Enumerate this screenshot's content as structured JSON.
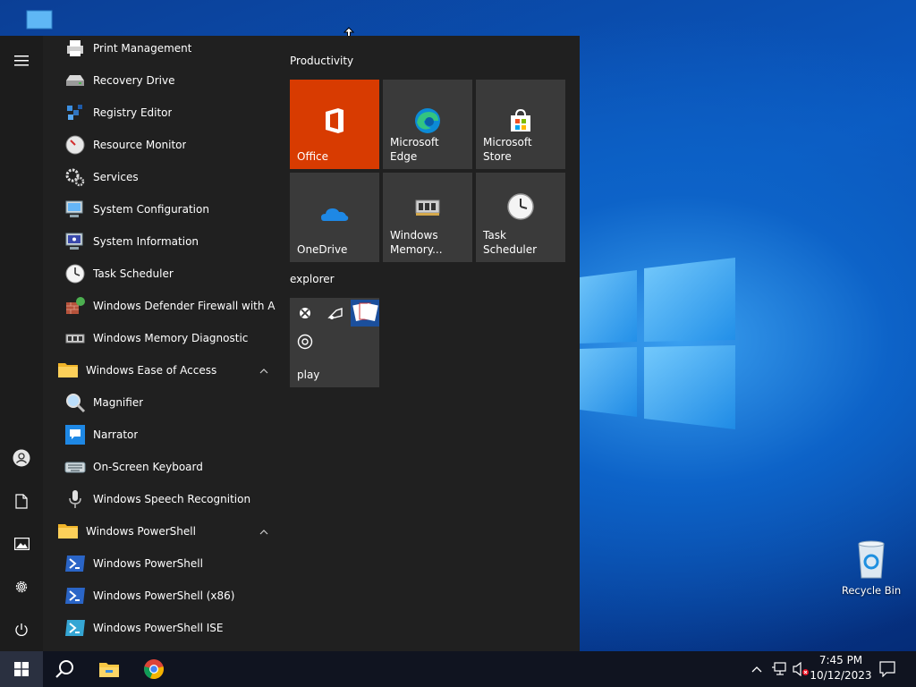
{
  "desktop": {
    "icons": [
      {
        "name": "Recycle Bin"
      }
    ]
  },
  "start_menu": {
    "rail": {
      "menu_icon": "hamburger-icon",
      "user_icon": "user-icon",
      "documents_icon": "document-icon",
      "pictures_icon": "pictures-icon",
      "settings_icon": "gear-icon",
      "power_icon": "power-icon"
    },
    "apps": [
      {
        "name": "Print Management",
        "icon": "print-management-icon"
      },
      {
        "name": "Recovery Drive",
        "icon": "drive-icon"
      },
      {
        "name": "Registry Editor",
        "icon": "registry-icon"
      },
      {
        "name": "Resource Monitor",
        "icon": "resource-monitor-icon"
      },
      {
        "name": "Services",
        "icon": "services-gear-icon"
      },
      {
        "name": "System Configuration",
        "icon": "system-configuration-icon"
      },
      {
        "name": "System Information",
        "icon": "system-information-icon"
      },
      {
        "name": "Task Scheduler",
        "icon": "clock-icon"
      },
      {
        "name": "Windows Defender Firewall with Ad...",
        "icon": "firewall-icon"
      },
      {
        "name": "Windows Memory Diagnostic",
        "icon": "memory-chip-icon"
      },
      {
        "name": "Windows Ease of Access",
        "icon": "folder-icon",
        "folder": true,
        "expanded": true
      },
      {
        "name": "Magnifier",
        "icon": "magnifier-icon"
      },
      {
        "name": "Narrator",
        "icon": "narrator-icon"
      },
      {
        "name": "On-Screen Keyboard",
        "icon": "keyboard-icon"
      },
      {
        "name": "Windows Speech Recognition",
        "icon": "microphone-icon"
      },
      {
        "name": "Windows PowerShell",
        "icon": "folder-icon",
        "folder": true,
        "expanded": true
      },
      {
        "name": "Windows PowerShell",
        "icon": "powershell-icon"
      },
      {
        "name": "Windows PowerShell (x86)",
        "icon": "powershell-icon"
      },
      {
        "name": "Windows PowerShell ISE",
        "icon": "powershell-ise-icon"
      }
    ],
    "tile_groups": [
      {
        "title": "Productivity",
        "tiles": [
          {
            "label": "Office",
            "icon": "office-icon",
            "bg": "#d83b01"
          },
          {
            "label": "Microsoft Edge",
            "icon": "edge-icon",
            "bg": "#3a3a3a"
          },
          {
            "label": "Microsoft Store",
            "icon": "store-icon",
            "bg": "#3a3a3a"
          },
          {
            "label": "OneDrive",
            "icon": "onedrive-icon",
            "bg": "#3a3a3a"
          },
          {
            "label": "Windows Memory...",
            "icon": "memory-chip-icon",
            "bg": "#3a3a3a"
          },
          {
            "label": "Task Scheduler",
            "icon": "clock-icon",
            "bg": "#3a3a3a"
          }
        ]
      },
      {
        "title": "explorer",
        "tiles": [
          {
            "label": "play",
            "icon": "play-folder-icon",
            "bg": "#3a3a3a",
            "mini_icons": [
              "xbox-icon",
              "music-icon",
              "solitaire-icon",
              "groove-icon"
            ]
          }
        ]
      }
    ]
  },
  "taskbar": {
    "start_icon": "windows-logo-icon",
    "search_icon": "search-icon",
    "pinned": [
      {
        "name": "File Explorer",
        "icon": "file-explorer-icon"
      },
      {
        "name": "Google Chrome",
        "icon": "chrome-icon"
      }
    ],
    "tray": {
      "chevron_icon": "chevron-up-icon",
      "network_icon": "network-icon",
      "volume_icon": "volume-muted-icon",
      "time": "7:45 PM",
      "date": "10/12/2023",
      "notification_icon": "notification-icon"
    }
  },
  "colors": {
    "start_bg": "#202020",
    "taskbar_bg": "#101420",
    "accent_office": "#d83b01",
    "tile_bg": "#3a3a3a"
  }
}
